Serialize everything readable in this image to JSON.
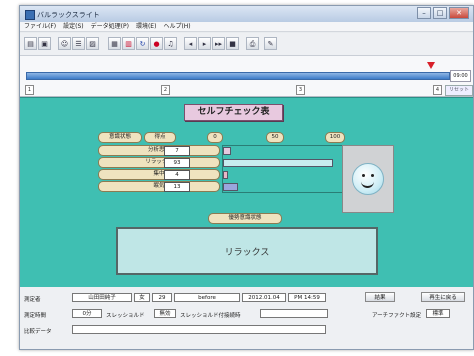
{
  "window": {
    "title": "バルラックスライト",
    "controls": {
      "minimize": "–",
      "maximize": "□",
      "close": "✕"
    }
  },
  "menu": [
    "ファイル(F)",
    "設定(S)",
    "データ処理(P)",
    "環境(E)",
    "ヘルプ(H)"
  ],
  "toolbar": {
    "icons": [
      "new-file-icon",
      "save-icon",
      "user-icon",
      "user-list-icon",
      "image-icon",
      "print-preview-icon",
      "report-icon",
      "rotate-icon",
      "record-icon",
      "music-icon",
      "rewind-icon",
      "play-icon",
      "fast-forward-icon",
      "stop-icon",
      "print-icon",
      "edit-icon"
    ],
    "glyphs": {
      "play": "▸",
      "rewind": "◂",
      "forward": "▸▸",
      "stop": "■",
      "print": "⎙",
      "edit": "✎"
    }
  },
  "timeline": {
    "time_value": "09:00",
    "reset_label": "リセット",
    "position_fraction": 0.96,
    "ticks": [
      "1",
      "2",
      "3",
      "4"
    ]
  },
  "self_check": {
    "title": "セルフチェック表",
    "header": {
      "status_label": "意識状態",
      "score_label": "得点",
      "scale": [
        "0",
        "50",
        "100"
      ]
    },
    "rows": [
      {
        "label": "分析思考",
        "value": "7",
        "fraction": 0.07,
        "color": "#e6c8df"
      },
      {
        "label": "リラックス",
        "value": "93",
        "fraction": 0.93,
        "color": "#c8ecef"
      },
      {
        "label": "集中",
        "value": "4",
        "fraction": 0.04,
        "color": "#e9b7c7"
      },
      {
        "label": "眠気",
        "value": "13",
        "fraction": 0.13,
        "color": "#9aa6dd"
      }
    ],
    "state_label": "優勢意識状態",
    "state_value": "リラックス",
    "face_icon": "smiley-face-icon"
  },
  "footer": {
    "measurer_label": "測定者",
    "measurer_name": "山田田純子",
    "sex": "女",
    "age": "29",
    "phase": "before",
    "date": "2012.01.04",
    "time": "PM 14:59",
    "result_button": "結果",
    "back_button": "再生に戻る",
    "duration_label": "測定時間",
    "duration_value": "0分",
    "threshold_label": "スレッショルド",
    "threshold_value": "無効",
    "threshold_set_label": "スレッショルド付接続時",
    "artifact_label": "アーチファクト設定",
    "artifact_value": "標準",
    "compare_label": "比較データ"
  },
  "colors": {
    "main_bg": "#3fbfb2",
    "title_box": "#e8c9df",
    "pill": "#efe3bf",
    "timeline_track": "#3d7cc8",
    "marker": "#d8202a"
  }
}
